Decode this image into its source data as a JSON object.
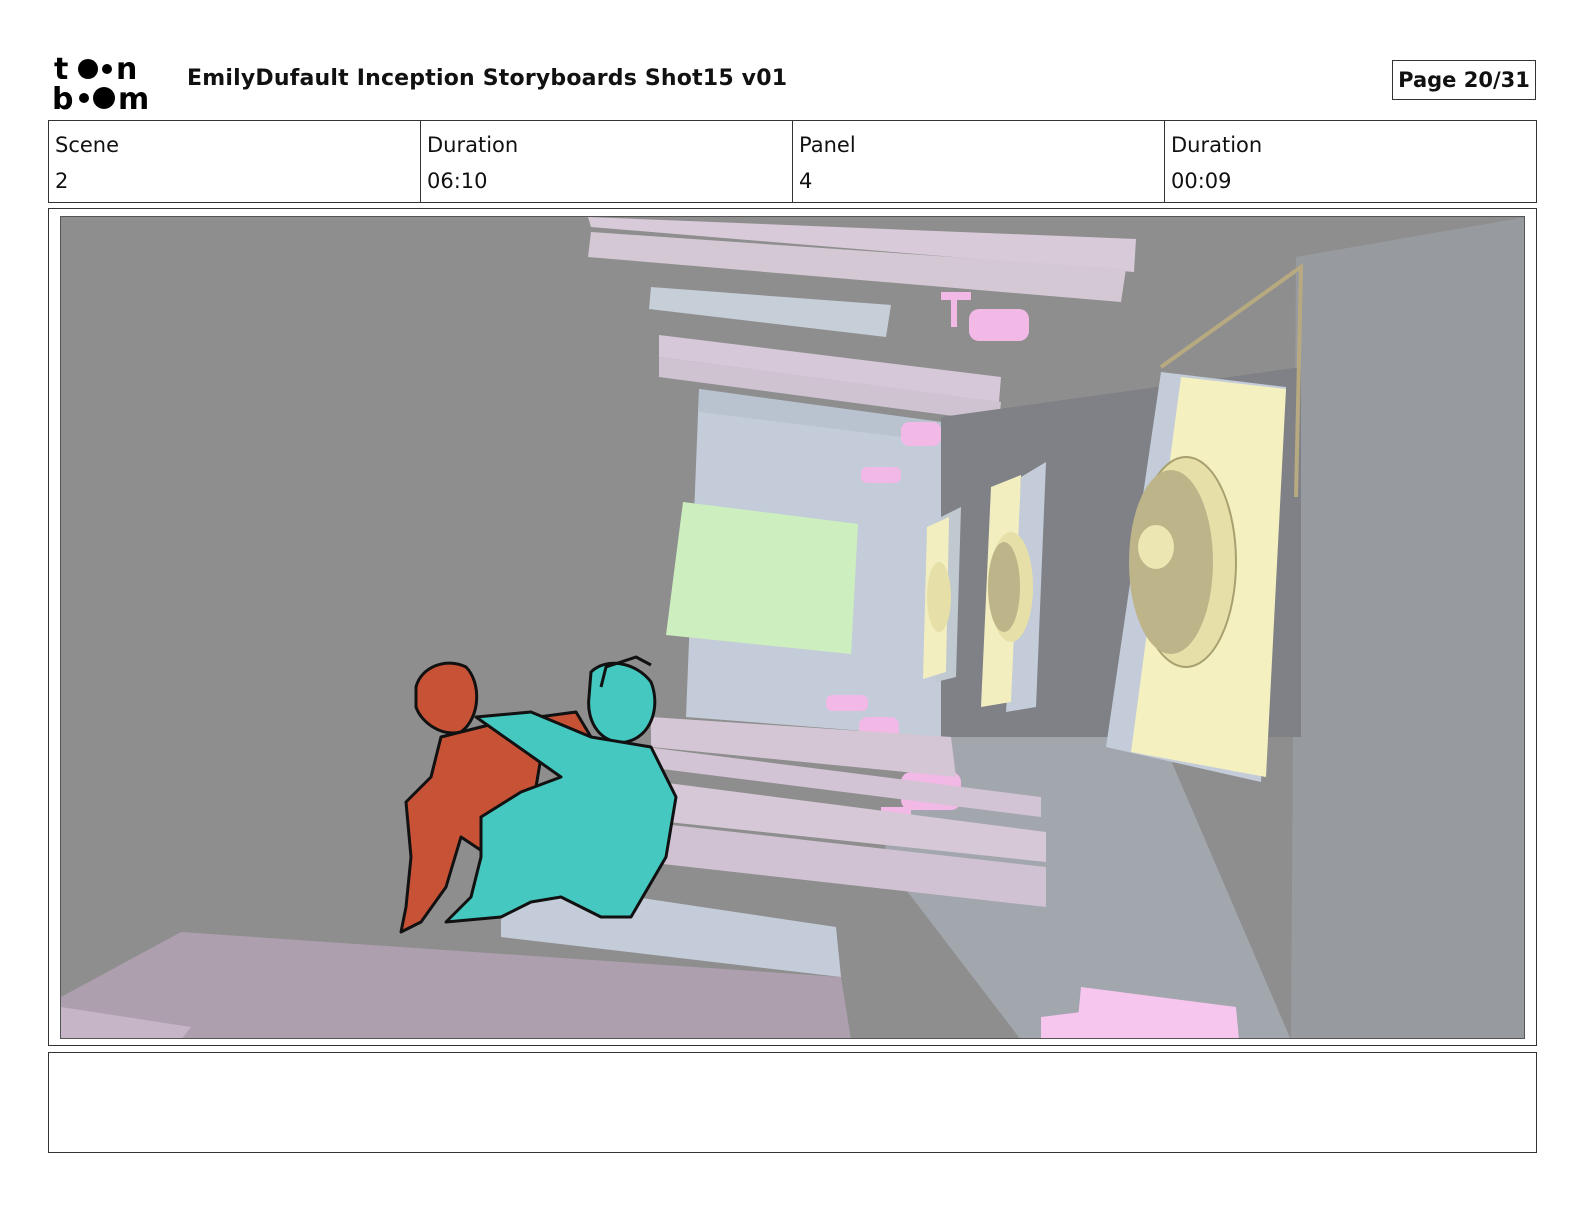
{
  "header": {
    "logo_text": "toon boom",
    "title": "EmilyDufault Inception Storyboards Shot15 v01",
    "page_label": "Page 20/31"
  },
  "info": {
    "scene_label": "Scene",
    "scene_value": "2",
    "scene_duration_label": "Duration",
    "scene_duration_value": "06:10",
    "panel_label": "Panel",
    "panel_value": "4",
    "panel_duration_label": "Duration",
    "panel_duration_value": "00:09"
  },
  "notes": {
    "text": ""
  },
  "colors": {
    "background_gray": "#8e8e8e",
    "character_red": "#c85236",
    "character_teal": "#45c8c0",
    "pink_props": "#f2b8e6",
    "pale_yellow": "#f4f0c0",
    "pale_green": "#cdeebf",
    "pale_blue": "#c3ccd8"
  }
}
